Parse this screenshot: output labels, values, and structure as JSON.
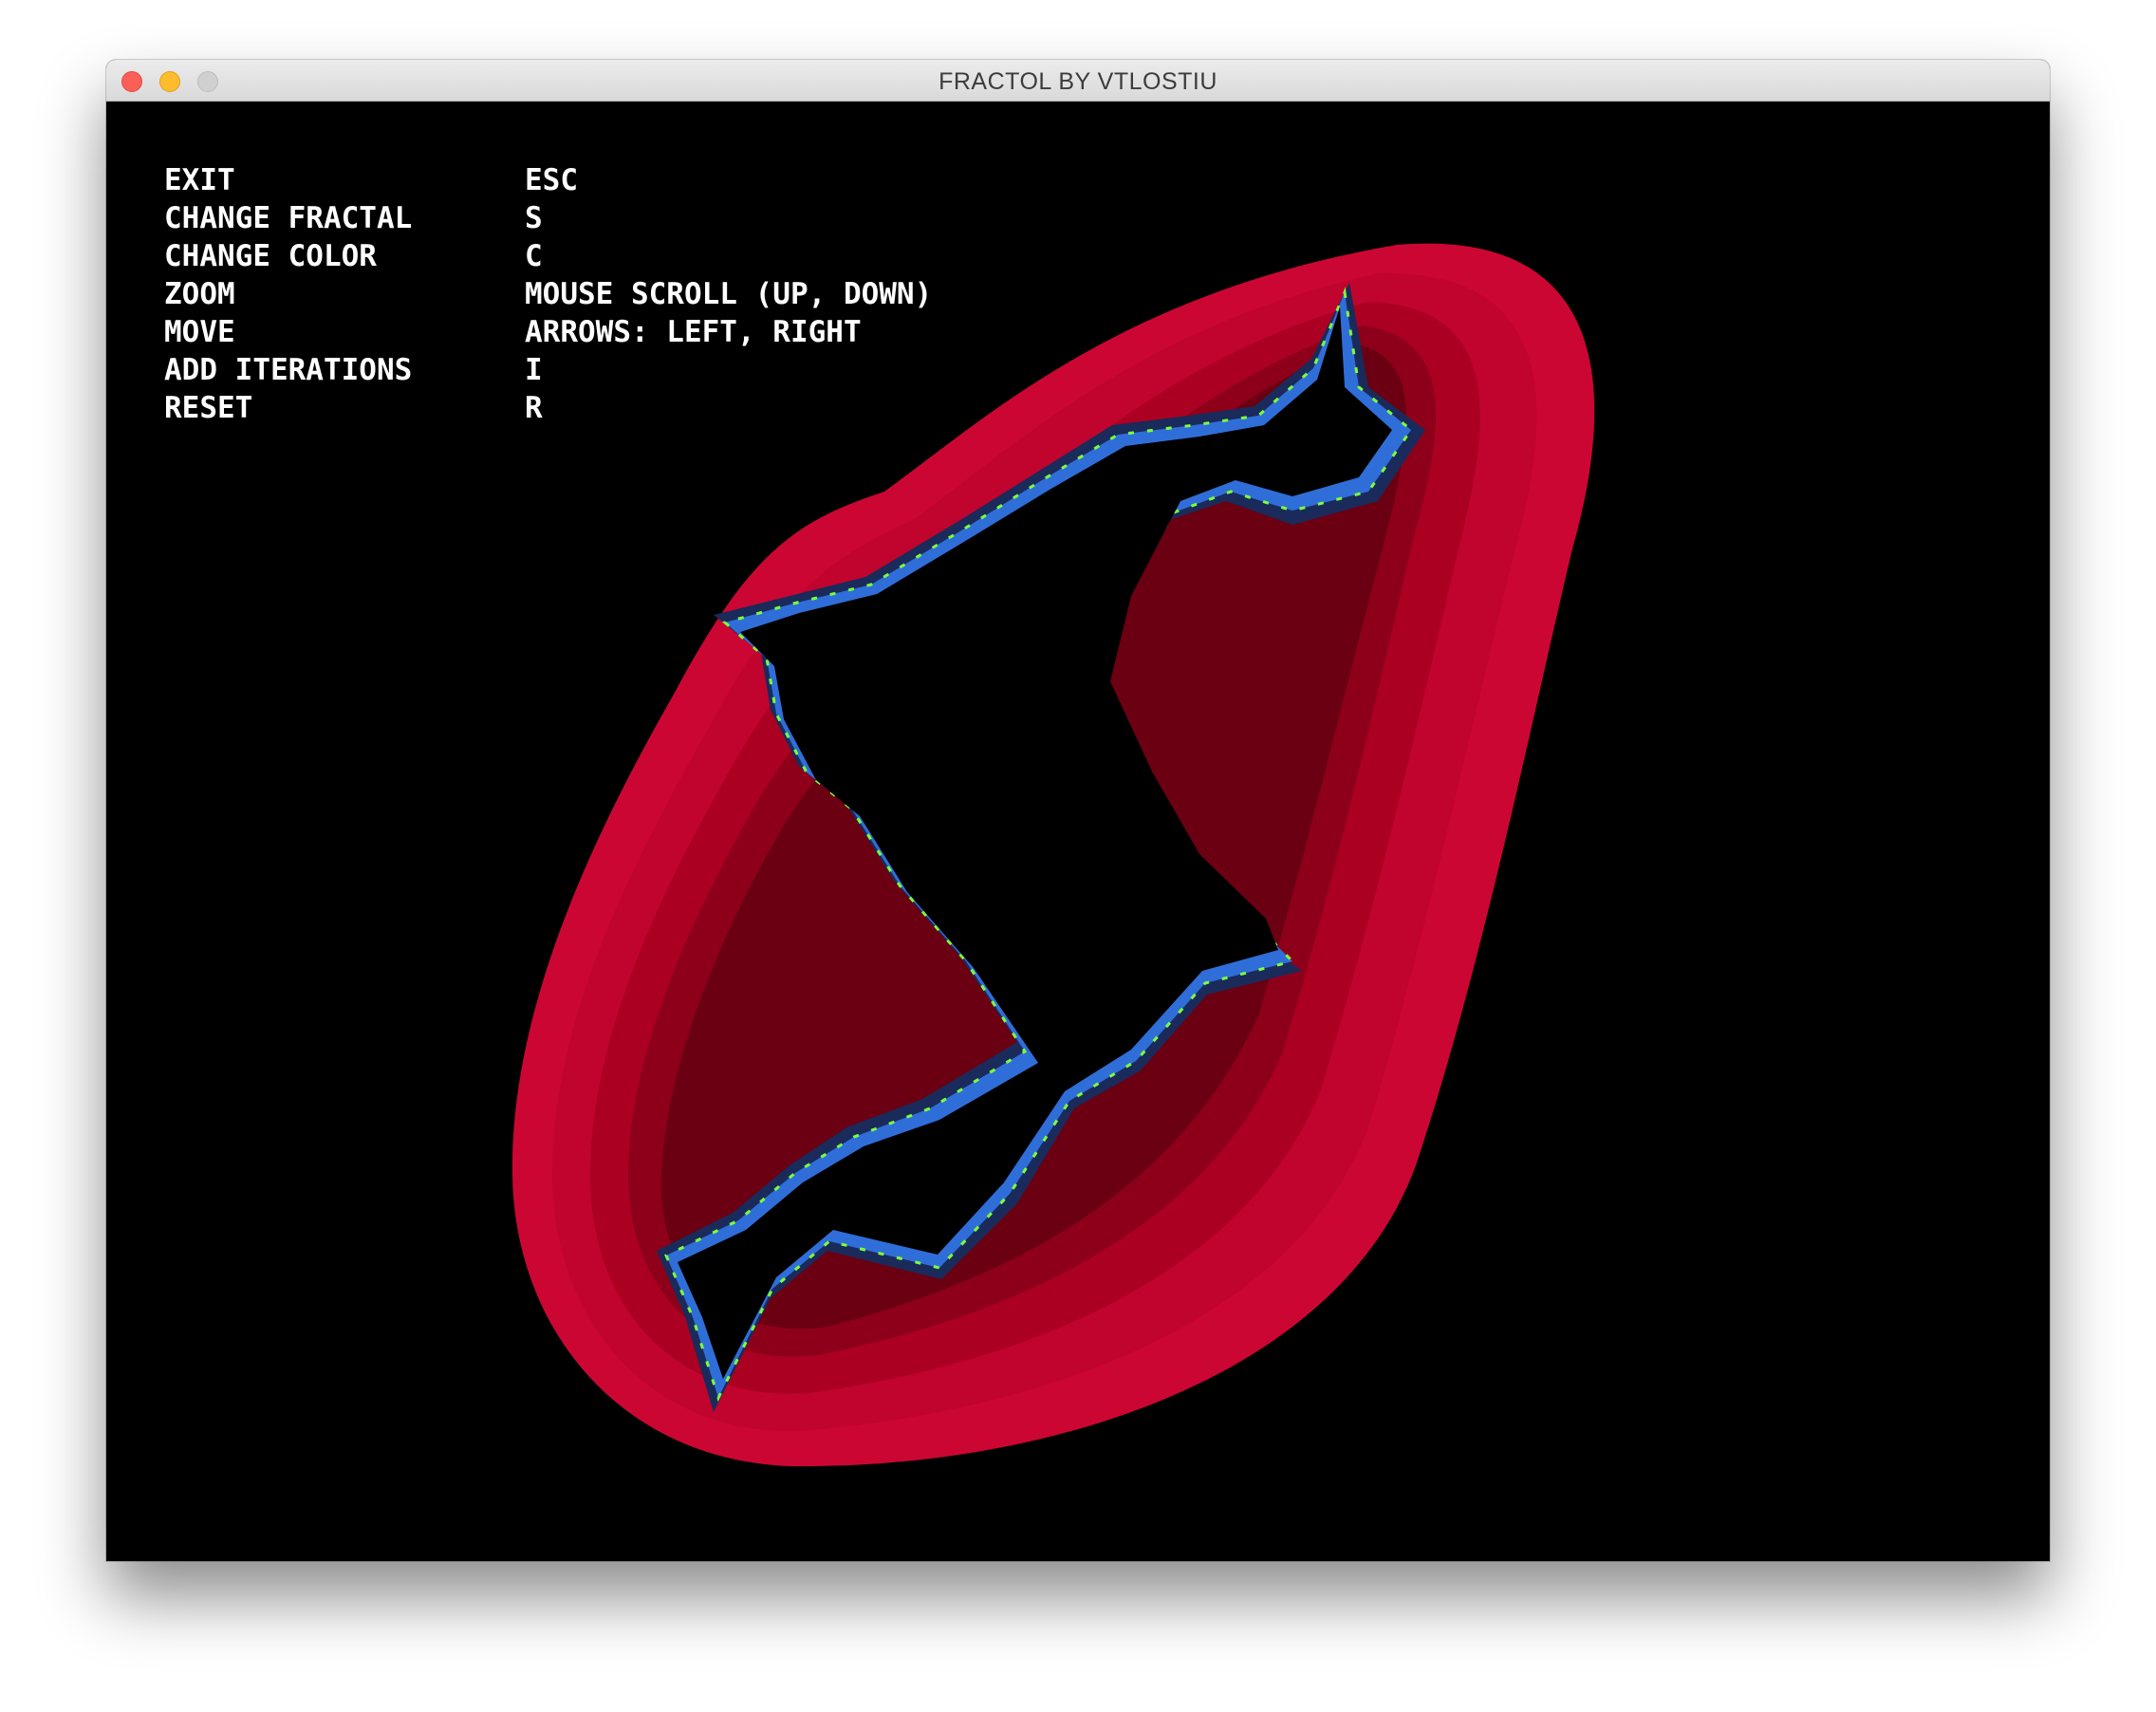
{
  "window": {
    "title": "FRACTOL BY VTLOSTIU"
  },
  "controls": [
    {
      "action": "EXIT",
      "key": "ESC"
    },
    {
      "action": "CHANGE FRACTAL",
      "key": "S"
    },
    {
      "action": "CHANGE COLOR",
      "key": "C"
    },
    {
      "action": "ZOOM",
      "key": "MOUSE SCROLL (UP, DOWN)"
    },
    {
      "action": "MOVE",
      "key": "ARROWS: LEFT, RIGHT"
    },
    {
      "action": "ADD ITERATIONS",
      "key": "I"
    },
    {
      "action": "RESET",
      "key": "R"
    }
  ],
  "fractal": {
    "type": "julia",
    "palette": {
      "background": "#000000",
      "outer": "#cc0633",
      "band_1": "#c0042d",
      "band_2": "#ac0022",
      "band_3": "#8e001a",
      "band_4": "#6a0012",
      "edge_dark": "#1a2a5a",
      "edge_blue": "#2f6ed8",
      "edge_light": "#8ab8ff",
      "fringe_green": "#7dff3a",
      "interior": "#000000"
    }
  }
}
